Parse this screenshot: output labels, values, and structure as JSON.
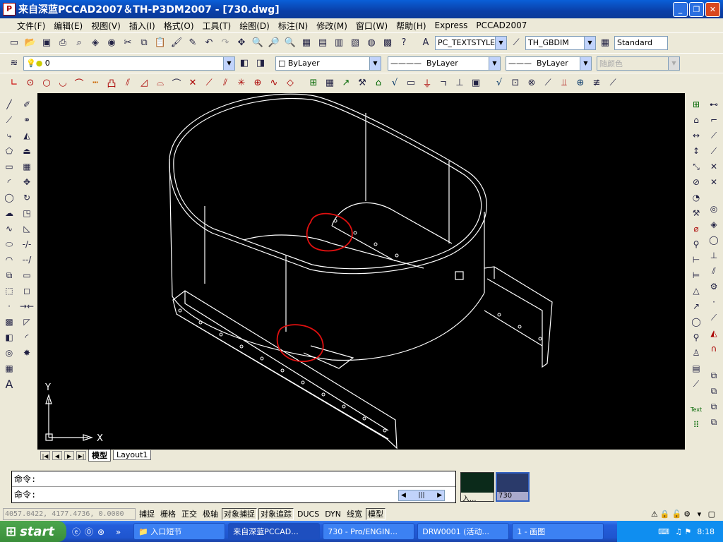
{
  "window": {
    "title": "来自深蓝PCCAD2007＆TH-P3DM2007 - [730.dwg]",
    "controls": [
      "minimize",
      "restore",
      "close"
    ]
  },
  "menu": [
    "文件(F)",
    "编辑(E)",
    "视图(V)",
    "插入(I)",
    "格式(O)",
    "工具(T)",
    "绘图(D)",
    "标注(N)",
    "修改(M)",
    "窗口(W)",
    "帮助(H)",
    "Express",
    "PCCAD2007"
  ],
  "toolbar": {
    "text_style": "PC_TEXTSTYLE",
    "dim_style": "TH_GBDIM",
    "table_style": "Standard",
    "layer": "0",
    "color": "ByLayer",
    "linetype": "ByLayer",
    "lineweight": "ByLayer",
    "plot_style": "随颜色"
  },
  "drawing": {
    "axis_y": "Y",
    "axis_x": "X",
    "line_color": "#ffffff",
    "markup_color": "#e01010",
    "background": "#000000"
  },
  "tabs": [
    "模型",
    "Layout1"
  ],
  "command": {
    "line1": "命令:",
    "line2": "命令:"
  },
  "thumbnails": [
    "入...",
    "730"
  ],
  "status": {
    "coords": "4057.0422, 4177.4736, 0.0000",
    "toggles": [
      {
        "label": "捕捉",
        "on": false
      },
      {
        "label": "栅格",
        "on": false
      },
      {
        "label": "正交",
        "on": false
      },
      {
        "label": "极轴",
        "on": false
      },
      {
        "label": "对象捕捉",
        "on": true
      },
      {
        "label": "对象追踪",
        "on": true
      },
      {
        "label": "DUCS",
        "on": false
      },
      {
        "label": "DYN",
        "on": false
      },
      {
        "label": "线宽",
        "on": false
      },
      {
        "label": "模型",
        "on": true
      }
    ]
  },
  "taskbar": {
    "start": "start",
    "tasks": [
      "入口短节",
      "来自深蓝PCCAD...",
      "730 - Pro/ENGIN...",
      "DRW0001 (活动...",
      "1 - 画图"
    ],
    "clock": "8:18"
  }
}
